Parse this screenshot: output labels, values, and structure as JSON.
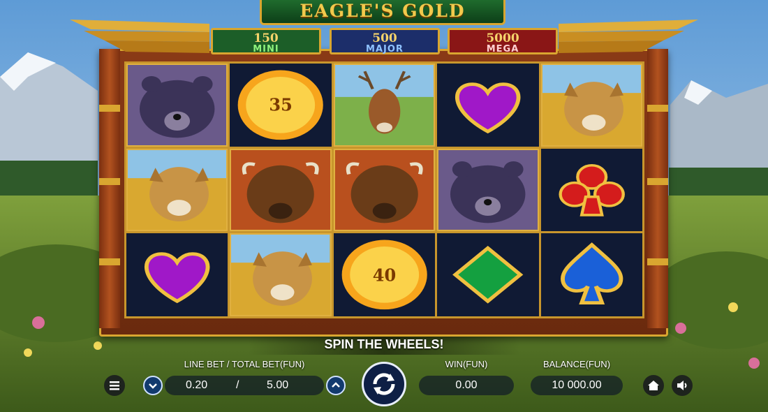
{
  "game": {
    "title": "EAGLE'S GOLD"
  },
  "jackpots": [
    {
      "amount": "150",
      "label": "MINI"
    },
    {
      "amount": "500",
      "label": "MAJOR"
    },
    {
      "amount": "5000",
      "label": "MEGA"
    }
  ],
  "reels": [
    [
      "bear",
      "sun",
      "deer",
      "purple-heart",
      "cougar"
    ],
    [
      "cougar",
      "bison",
      "bison",
      "bear",
      "red-club"
    ],
    [
      "purple-heart",
      "cougar",
      "sun",
      "green-diamond",
      "blue-spade"
    ]
  ],
  "sun_values": {
    "r0c1": "35",
    "r2c2": "40"
  },
  "message": "SPIN THE WHEELS!",
  "controls": {
    "bet_label": "LINE BET / TOTAL BET(FUN)",
    "line_bet": "0.20",
    "separator": "/",
    "total_bet": "5.00",
    "win_label": "WIN(FUN)",
    "win": "0.00",
    "balance_label": "BALANCE(FUN)",
    "balance": "10 000.00"
  },
  "icons": [
    "menu-icon",
    "decrease-bet-icon",
    "increase-bet-icon",
    "spin-icon",
    "home-icon",
    "sound-icon"
  ]
}
